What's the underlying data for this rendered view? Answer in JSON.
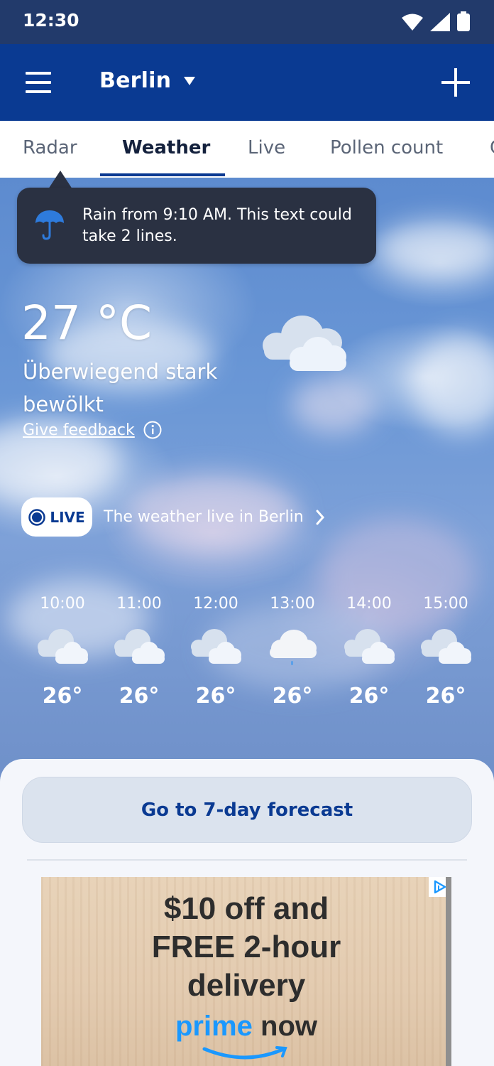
{
  "status_bar": {
    "time": "12:30",
    "icons": [
      "wifi-icon",
      "cellular-signal-icon",
      "battery-icon"
    ]
  },
  "app_bar": {
    "city": "Berlin",
    "menu_icon": "hamburger-menu-icon",
    "dropdown_icon": "dropdown-caret-icon",
    "add_icon": "plus-icon"
  },
  "tabs": [
    {
      "label": "Radar",
      "active": false
    },
    {
      "label": "Weather",
      "active": true
    },
    {
      "label": "Live",
      "active": false
    },
    {
      "label": "Pollen count",
      "active": false
    }
  ],
  "tooltip": {
    "icon": "umbrella-icon",
    "text": "Rain from 9:10 AM. This text could take 2 lines."
  },
  "current": {
    "temperature": "27 °C",
    "condition": "Überwiegend stark bewölkt",
    "icon": "cloudy-icon",
    "feedback_label": "Give feedback",
    "feedback_icon": "info-icon"
  },
  "live": {
    "badge": "LIVE",
    "text": "The weather live in Berlin",
    "chevron_icon": "chevron-right-icon"
  },
  "hourly": [
    {
      "time": "10:00",
      "temp": "26°",
      "icon": "cloudy-icon"
    },
    {
      "time": "11:00",
      "temp": "26°",
      "icon": "cloudy-icon"
    },
    {
      "time": "12:00",
      "temp": "26°",
      "icon": "cloudy-icon"
    },
    {
      "time": "13:00",
      "temp": "26°",
      "icon": "light-rain-icon"
    },
    {
      "time": "14:00",
      "temp": "26°",
      "icon": "cloudy-icon"
    },
    {
      "time": "15:00",
      "temp": "26°",
      "icon": "cloudy-icon"
    }
  ],
  "forecast_button": "Go to 7-day forecast",
  "ad": {
    "line1": "$10 off and",
    "line2": "FREE 2-hour",
    "line3": "delivery",
    "brand1": "prime",
    "brand2": "now",
    "badge_icon": "adchoices-icon"
  },
  "colors": {
    "status_bar": "#223a6b",
    "app_bar": "#0a3a92",
    "accent": "#0a3a92",
    "tooltip_bg": "#2a3142",
    "umbrella": "#2e7bdc",
    "forecast_button_bg": "#dbe3ee"
  }
}
